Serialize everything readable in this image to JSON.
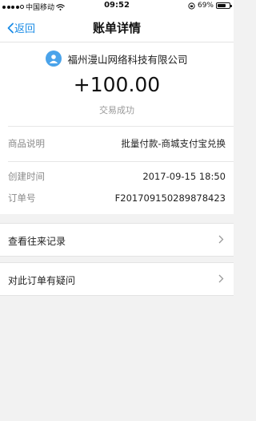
{
  "status_bar": {
    "carrier": "中国移动",
    "time": "09:52",
    "battery_percent": "69%",
    "battery_level": 0.69
  },
  "nav": {
    "back_label": "返回",
    "title": "账单详情"
  },
  "summary": {
    "payee": "福州漫山网络科技有限公司",
    "amount": "+100.00",
    "status": "交易成功"
  },
  "details": [
    {
      "label": "商品说明",
      "value": "批量付款-商城支付宝兑换"
    },
    {
      "label": "创建时间",
      "value": "2017-09-15 18:50"
    },
    {
      "label": "订单号",
      "value": "F201709150289878423"
    }
  ],
  "actions": {
    "history": "查看往来记录",
    "question": "对此订单有疑问"
  },
  "colors": {
    "accent": "#1a8be6",
    "avatar": "#4aa3ea",
    "background": "#f2f2f2"
  }
}
